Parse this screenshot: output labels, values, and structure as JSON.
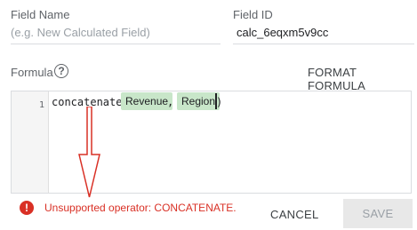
{
  "field_name": {
    "label": "Field Name",
    "value": "",
    "placeholder": "(e.g. New Calculated Field)"
  },
  "field_id": {
    "label": "Field ID",
    "value": "calc_6eqxm5v9cc"
  },
  "formula": {
    "label": "Formula",
    "help_icon": "question-mark-circle",
    "format_button_label": "FORMAT FORMULA",
    "editor": {
      "line_number": "1",
      "function_text": "concatenate (",
      "separator": ",",
      "closing": ")",
      "field_chips": [
        "Revenue",
        "Region"
      ],
      "chip_color": "#c8e6c9"
    }
  },
  "annotation": {
    "type": "red-outlined-down-arrow",
    "color": "#d93025"
  },
  "error": {
    "icon": "exclamation-circle",
    "message": "Unsupported operator: CONCATENATE.",
    "color": "#d93025"
  },
  "actions": {
    "cancel_label": "CANCEL",
    "save_label": "SAVE",
    "save_disabled": true
  }
}
